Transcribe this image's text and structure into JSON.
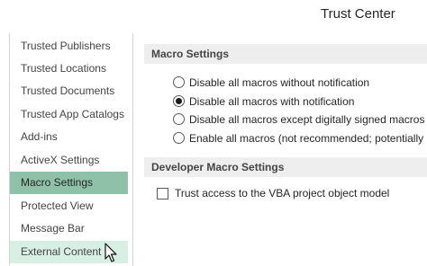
{
  "window": {
    "title": "Trust Center"
  },
  "sidebar": {
    "items": [
      {
        "label": "Trusted Publishers"
      },
      {
        "label": "Trusted Locations"
      },
      {
        "label": "Trusted Documents"
      },
      {
        "label": "Trusted App Catalogs"
      },
      {
        "label": "Add-ins"
      },
      {
        "label": "ActiveX Settings"
      },
      {
        "label": "Macro Settings"
      },
      {
        "label": "Protected View"
      },
      {
        "label": "Message Bar"
      },
      {
        "label": "External Content"
      }
    ],
    "selected": "Macro Settings",
    "hovered": "External Content"
  },
  "macro_settings": {
    "header": "Macro Settings",
    "options": [
      {
        "label": "Disable all macros without notification",
        "selected": false
      },
      {
        "label": "Disable all macros with notification",
        "selected": true
      },
      {
        "label": "Disable all macros except digitally signed macros",
        "selected": false
      },
      {
        "label": "Enable all macros (not recommended; potentially dangerous code can run)",
        "selected": false
      }
    ]
  },
  "developer_settings": {
    "header": "Developer Macro Settings",
    "trust_vba_label": "Trust access to the VBA project object model",
    "trust_vba_checked": false
  },
  "colors": {
    "selected_item": "#8fc1a8",
    "hover_item": "#d8efe3",
    "section_header_bg": "#eeeeee"
  },
  "icons": {
    "pointer": "arrow-cursor-icon"
  }
}
